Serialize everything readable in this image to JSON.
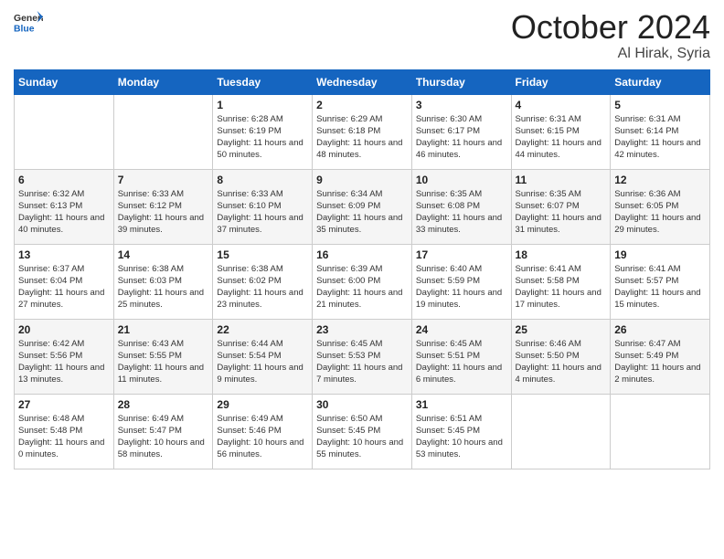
{
  "header": {
    "logo_general": "General",
    "logo_blue": "Blue",
    "month_title": "October 2024",
    "location": "Al Hirak, Syria"
  },
  "weekdays": [
    "Sunday",
    "Monday",
    "Tuesday",
    "Wednesday",
    "Thursday",
    "Friday",
    "Saturday"
  ],
  "weeks": [
    [
      {
        "day": "",
        "sunrise": "",
        "sunset": "",
        "daylight": ""
      },
      {
        "day": "",
        "sunrise": "",
        "sunset": "",
        "daylight": ""
      },
      {
        "day": "1",
        "sunrise": "Sunrise: 6:28 AM",
        "sunset": "Sunset: 6:19 PM",
        "daylight": "Daylight: 11 hours and 50 minutes."
      },
      {
        "day": "2",
        "sunrise": "Sunrise: 6:29 AM",
        "sunset": "Sunset: 6:18 PM",
        "daylight": "Daylight: 11 hours and 48 minutes."
      },
      {
        "day": "3",
        "sunrise": "Sunrise: 6:30 AM",
        "sunset": "Sunset: 6:17 PM",
        "daylight": "Daylight: 11 hours and 46 minutes."
      },
      {
        "day": "4",
        "sunrise": "Sunrise: 6:31 AM",
        "sunset": "Sunset: 6:15 PM",
        "daylight": "Daylight: 11 hours and 44 minutes."
      },
      {
        "day": "5",
        "sunrise": "Sunrise: 6:31 AM",
        "sunset": "Sunset: 6:14 PM",
        "daylight": "Daylight: 11 hours and 42 minutes."
      }
    ],
    [
      {
        "day": "6",
        "sunrise": "Sunrise: 6:32 AM",
        "sunset": "Sunset: 6:13 PM",
        "daylight": "Daylight: 11 hours and 40 minutes."
      },
      {
        "day": "7",
        "sunrise": "Sunrise: 6:33 AM",
        "sunset": "Sunset: 6:12 PM",
        "daylight": "Daylight: 11 hours and 39 minutes."
      },
      {
        "day": "8",
        "sunrise": "Sunrise: 6:33 AM",
        "sunset": "Sunset: 6:10 PM",
        "daylight": "Daylight: 11 hours and 37 minutes."
      },
      {
        "day": "9",
        "sunrise": "Sunrise: 6:34 AM",
        "sunset": "Sunset: 6:09 PM",
        "daylight": "Daylight: 11 hours and 35 minutes."
      },
      {
        "day": "10",
        "sunrise": "Sunrise: 6:35 AM",
        "sunset": "Sunset: 6:08 PM",
        "daylight": "Daylight: 11 hours and 33 minutes."
      },
      {
        "day": "11",
        "sunrise": "Sunrise: 6:35 AM",
        "sunset": "Sunset: 6:07 PM",
        "daylight": "Daylight: 11 hours and 31 minutes."
      },
      {
        "day": "12",
        "sunrise": "Sunrise: 6:36 AM",
        "sunset": "Sunset: 6:05 PM",
        "daylight": "Daylight: 11 hours and 29 minutes."
      }
    ],
    [
      {
        "day": "13",
        "sunrise": "Sunrise: 6:37 AM",
        "sunset": "Sunset: 6:04 PM",
        "daylight": "Daylight: 11 hours and 27 minutes."
      },
      {
        "day": "14",
        "sunrise": "Sunrise: 6:38 AM",
        "sunset": "Sunset: 6:03 PM",
        "daylight": "Daylight: 11 hours and 25 minutes."
      },
      {
        "day": "15",
        "sunrise": "Sunrise: 6:38 AM",
        "sunset": "Sunset: 6:02 PM",
        "daylight": "Daylight: 11 hours and 23 minutes."
      },
      {
        "day": "16",
        "sunrise": "Sunrise: 6:39 AM",
        "sunset": "Sunset: 6:00 PM",
        "daylight": "Daylight: 11 hours and 21 minutes."
      },
      {
        "day": "17",
        "sunrise": "Sunrise: 6:40 AM",
        "sunset": "Sunset: 5:59 PM",
        "daylight": "Daylight: 11 hours and 19 minutes."
      },
      {
        "day": "18",
        "sunrise": "Sunrise: 6:41 AM",
        "sunset": "Sunset: 5:58 PM",
        "daylight": "Daylight: 11 hours and 17 minutes."
      },
      {
        "day": "19",
        "sunrise": "Sunrise: 6:41 AM",
        "sunset": "Sunset: 5:57 PM",
        "daylight": "Daylight: 11 hours and 15 minutes."
      }
    ],
    [
      {
        "day": "20",
        "sunrise": "Sunrise: 6:42 AM",
        "sunset": "Sunset: 5:56 PM",
        "daylight": "Daylight: 11 hours and 13 minutes."
      },
      {
        "day": "21",
        "sunrise": "Sunrise: 6:43 AM",
        "sunset": "Sunset: 5:55 PM",
        "daylight": "Daylight: 11 hours and 11 minutes."
      },
      {
        "day": "22",
        "sunrise": "Sunrise: 6:44 AM",
        "sunset": "Sunset: 5:54 PM",
        "daylight": "Daylight: 11 hours and 9 minutes."
      },
      {
        "day": "23",
        "sunrise": "Sunrise: 6:45 AM",
        "sunset": "Sunset: 5:53 PM",
        "daylight": "Daylight: 11 hours and 7 minutes."
      },
      {
        "day": "24",
        "sunrise": "Sunrise: 6:45 AM",
        "sunset": "Sunset: 5:51 PM",
        "daylight": "Daylight: 11 hours and 6 minutes."
      },
      {
        "day": "25",
        "sunrise": "Sunrise: 6:46 AM",
        "sunset": "Sunset: 5:50 PM",
        "daylight": "Daylight: 11 hours and 4 minutes."
      },
      {
        "day": "26",
        "sunrise": "Sunrise: 6:47 AM",
        "sunset": "Sunset: 5:49 PM",
        "daylight": "Daylight: 11 hours and 2 minutes."
      }
    ],
    [
      {
        "day": "27",
        "sunrise": "Sunrise: 6:48 AM",
        "sunset": "Sunset: 5:48 PM",
        "daylight": "Daylight: 11 hours and 0 minutes."
      },
      {
        "day": "28",
        "sunrise": "Sunrise: 6:49 AM",
        "sunset": "Sunset: 5:47 PM",
        "daylight": "Daylight: 10 hours and 58 minutes."
      },
      {
        "day": "29",
        "sunrise": "Sunrise: 6:49 AM",
        "sunset": "Sunset: 5:46 PM",
        "daylight": "Daylight: 10 hours and 56 minutes."
      },
      {
        "day": "30",
        "sunrise": "Sunrise: 6:50 AM",
        "sunset": "Sunset: 5:45 PM",
        "daylight": "Daylight: 10 hours and 55 minutes."
      },
      {
        "day": "31",
        "sunrise": "Sunrise: 6:51 AM",
        "sunset": "Sunset: 5:45 PM",
        "daylight": "Daylight: 10 hours and 53 minutes."
      },
      {
        "day": "",
        "sunrise": "",
        "sunset": "",
        "daylight": ""
      },
      {
        "day": "",
        "sunrise": "",
        "sunset": "",
        "daylight": ""
      }
    ]
  ]
}
